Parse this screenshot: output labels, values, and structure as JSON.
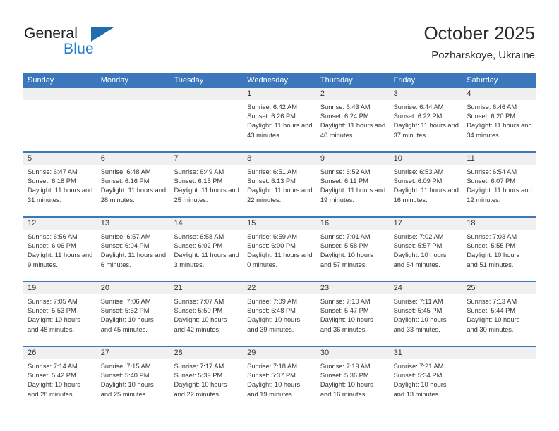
{
  "brand": {
    "name_part1": "General",
    "name_part2": "Blue",
    "triangle_color": "#1f6cb0",
    "blue_color": "#1f7fd0"
  },
  "header": {
    "title": "October 2025",
    "subtitle": "Pozharskoye, Ukraine"
  },
  "theme": {
    "header_bar": "#3b77ba",
    "day_band": "#f0f0f0",
    "text": "#333333"
  },
  "weekdays": [
    "Sunday",
    "Monday",
    "Tuesday",
    "Wednesday",
    "Thursday",
    "Friday",
    "Saturday"
  ],
  "weeks": [
    [
      {
        "empty": true
      },
      {
        "empty": true
      },
      {
        "empty": true
      },
      {
        "day": "1",
        "sunrise": "Sunrise: 6:42 AM",
        "sunset": "Sunset: 6:26 PM",
        "daylight": "Daylight: 11 hours and 43 minutes."
      },
      {
        "day": "2",
        "sunrise": "Sunrise: 6:43 AM",
        "sunset": "Sunset: 6:24 PM",
        "daylight": "Daylight: 11 hours and 40 minutes."
      },
      {
        "day": "3",
        "sunrise": "Sunrise: 6:44 AM",
        "sunset": "Sunset: 6:22 PM",
        "daylight": "Daylight: 11 hours and 37 minutes."
      },
      {
        "day": "4",
        "sunrise": "Sunrise: 6:46 AM",
        "sunset": "Sunset: 6:20 PM",
        "daylight": "Daylight: 11 hours and 34 minutes."
      }
    ],
    [
      {
        "day": "5",
        "sunrise": "Sunrise: 6:47 AM",
        "sunset": "Sunset: 6:18 PM",
        "daylight": "Daylight: 11 hours and 31 minutes."
      },
      {
        "day": "6",
        "sunrise": "Sunrise: 6:48 AM",
        "sunset": "Sunset: 6:16 PM",
        "daylight": "Daylight: 11 hours and 28 minutes."
      },
      {
        "day": "7",
        "sunrise": "Sunrise: 6:49 AM",
        "sunset": "Sunset: 6:15 PM",
        "daylight": "Daylight: 11 hours and 25 minutes."
      },
      {
        "day": "8",
        "sunrise": "Sunrise: 6:51 AM",
        "sunset": "Sunset: 6:13 PM",
        "daylight": "Daylight: 11 hours and 22 minutes."
      },
      {
        "day": "9",
        "sunrise": "Sunrise: 6:52 AM",
        "sunset": "Sunset: 6:11 PM",
        "daylight": "Daylight: 11 hours and 19 minutes."
      },
      {
        "day": "10",
        "sunrise": "Sunrise: 6:53 AM",
        "sunset": "Sunset: 6:09 PM",
        "daylight": "Daylight: 11 hours and 16 minutes."
      },
      {
        "day": "11",
        "sunrise": "Sunrise: 6:54 AM",
        "sunset": "Sunset: 6:07 PM",
        "daylight": "Daylight: 11 hours and 12 minutes."
      }
    ],
    [
      {
        "day": "12",
        "sunrise": "Sunrise: 6:56 AM",
        "sunset": "Sunset: 6:06 PM",
        "daylight": "Daylight: 11 hours and 9 minutes."
      },
      {
        "day": "13",
        "sunrise": "Sunrise: 6:57 AM",
        "sunset": "Sunset: 6:04 PM",
        "daylight": "Daylight: 11 hours and 6 minutes."
      },
      {
        "day": "14",
        "sunrise": "Sunrise: 6:58 AM",
        "sunset": "Sunset: 6:02 PM",
        "daylight": "Daylight: 11 hours and 3 minutes."
      },
      {
        "day": "15",
        "sunrise": "Sunrise: 6:59 AM",
        "sunset": "Sunset: 6:00 PM",
        "daylight": "Daylight: 11 hours and 0 minutes."
      },
      {
        "day": "16",
        "sunrise": "Sunrise: 7:01 AM",
        "sunset": "Sunset: 5:58 PM",
        "daylight": "Daylight: 10 hours and 57 minutes."
      },
      {
        "day": "17",
        "sunrise": "Sunrise: 7:02 AM",
        "sunset": "Sunset: 5:57 PM",
        "daylight": "Daylight: 10 hours and 54 minutes."
      },
      {
        "day": "18",
        "sunrise": "Sunrise: 7:03 AM",
        "sunset": "Sunset: 5:55 PM",
        "daylight": "Daylight: 10 hours and 51 minutes."
      }
    ],
    [
      {
        "day": "19",
        "sunrise": "Sunrise: 7:05 AM",
        "sunset": "Sunset: 5:53 PM",
        "daylight": "Daylight: 10 hours and 48 minutes."
      },
      {
        "day": "20",
        "sunrise": "Sunrise: 7:06 AM",
        "sunset": "Sunset: 5:52 PM",
        "daylight": "Daylight: 10 hours and 45 minutes."
      },
      {
        "day": "21",
        "sunrise": "Sunrise: 7:07 AM",
        "sunset": "Sunset: 5:50 PM",
        "daylight": "Daylight: 10 hours and 42 minutes."
      },
      {
        "day": "22",
        "sunrise": "Sunrise: 7:09 AM",
        "sunset": "Sunset: 5:48 PM",
        "daylight": "Daylight: 10 hours and 39 minutes."
      },
      {
        "day": "23",
        "sunrise": "Sunrise: 7:10 AM",
        "sunset": "Sunset: 5:47 PM",
        "daylight": "Daylight: 10 hours and 36 minutes."
      },
      {
        "day": "24",
        "sunrise": "Sunrise: 7:11 AM",
        "sunset": "Sunset: 5:45 PM",
        "daylight": "Daylight: 10 hours and 33 minutes."
      },
      {
        "day": "25",
        "sunrise": "Sunrise: 7:13 AM",
        "sunset": "Sunset: 5:44 PM",
        "daylight": "Daylight: 10 hours and 30 minutes."
      }
    ],
    [
      {
        "day": "26",
        "sunrise": "Sunrise: 7:14 AM",
        "sunset": "Sunset: 5:42 PM",
        "daylight": "Daylight: 10 hours and 28 minutes."
      },
      {
        "day": "27",
        "sunrise": "Sunrise: 7:15 AM",
        "sunset": "Sunset: 5:40 PM",
        "daylight": "Daylight: 10 hours and 25 minutes."
      },
      {
        "day": "28",
        "sunrise": "Sunrise: 7:17 AM",
        "sunset": "Sunset: 5:39 PM",
        "daylight": "Daylight: 10 hours and 22 minutes."
      },
      {
        "day": "29",
        "sunrise": "Sunrise: 7:18 AM",
        "sunset": "Sunset: 5:37 PM",
        "daylight": "Daylight: 10 hours and 19 minutes."
      },
      {
        "day": "30",
        "sunrise": "Sunrise: 7:19 AM",
        "sunset": "Sunset: 5:36 PM",
        "daylight": "Daylight: 10 hours and 16 minutes."
      },
      {
        "day": "31",
        "sunrise": "Sunrise: 7:21 AM",
        "sunset": "Sunset: 5:34 PM",
        "daylight": "Daylight: 10 hours and 13 minutes."
      },
      {
        "empty": true
      }
    ]
  ]
}
